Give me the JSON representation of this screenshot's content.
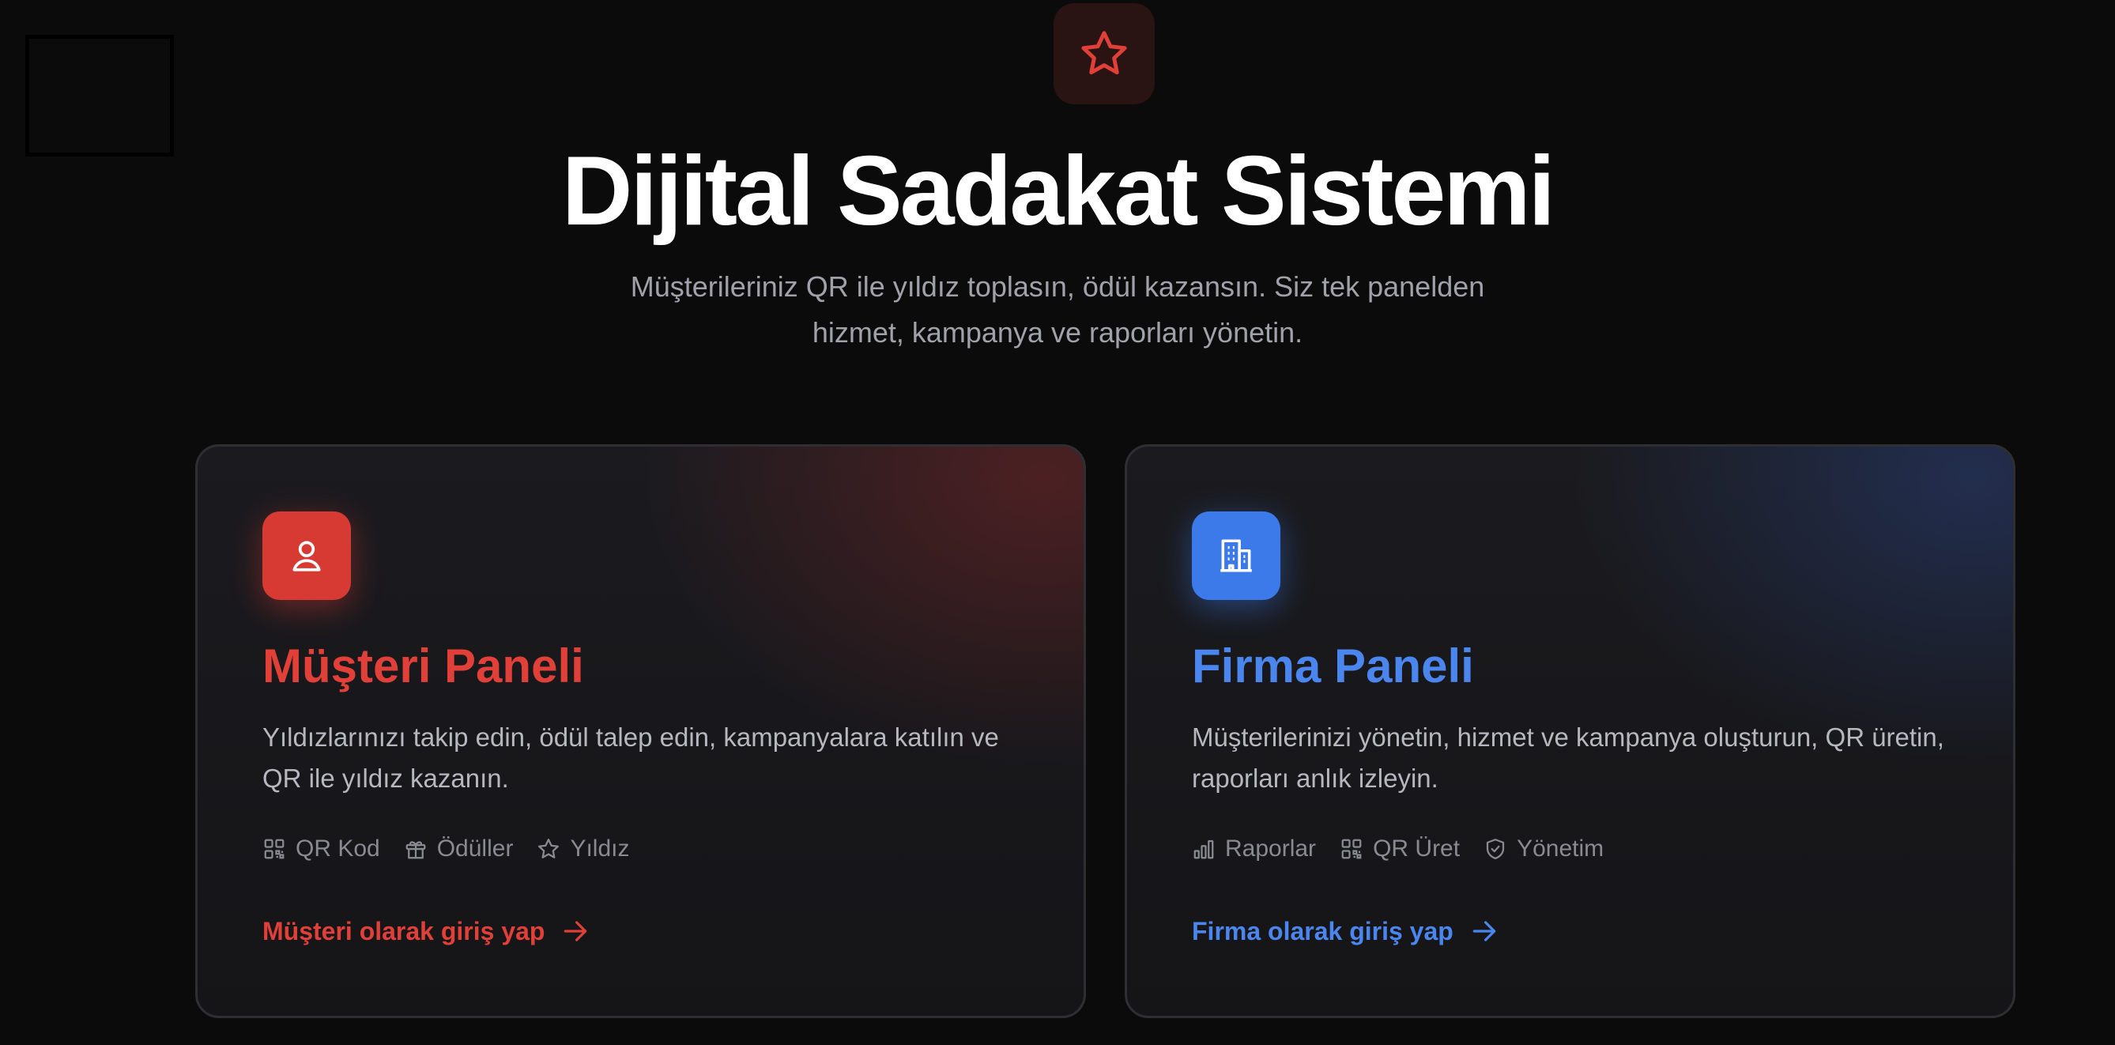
{
  "hero": {
    "icon": "star-icon",
    "title": "Dijital Sadakat Sistemi",
    "subtitle": "Müşterileriniz QR ile yıldız toplasın, ödül kazansın. Siz tek panelden hizmet, kampanya ve raporları yönetin."
  },
  "colors": {
    "background": "#0b0b0c",
    "customer_accent": "#d63a33",
    "company_accent": "#3b7ae8",
    "hero_icon_bg": "#2a1313"
  },
  "cards": {
    "customer": {
      "icon": "user-icon",
      "title": "Müşteri Paneli",
      "description": "Yıldızlarınızı takip edin, ödül talep edin, kampanyalara katılın ve QR ile yıldız kazanın.",
      "tags": [
        {
          "icon": "qr-code-icon",
          "label": "QR Kod"
        },
        {
          "icon": "gift-icon",
          "label": "Ödüller"
        },
        {
          "icon": "star-icon",
          "label": "Yıldız"
        }
      ],
      "link_label": "Müşteri olarak giriş yap"
    },
    "company": {
      "icon": "building-icon",
      "title": "Firma Paneli",
      "description": "Müşterilerinizi yönetin, hizmet ve kampanya oluşturun, QR üretin, raporları anlık izleyin.",
      "tags": [
        {
          "icon": "bar-chart-icon",
          "label": "Raporlar"
        },
        {
          "icon": "qr-code-icon",
          "label": "QR Üret"
        },
        {
          "icon": "shield-check-icon",
          "label": "Yönetim"
        }
      ],
      "link_label": "Firma olarak giriş yap"
    }
  }
}
